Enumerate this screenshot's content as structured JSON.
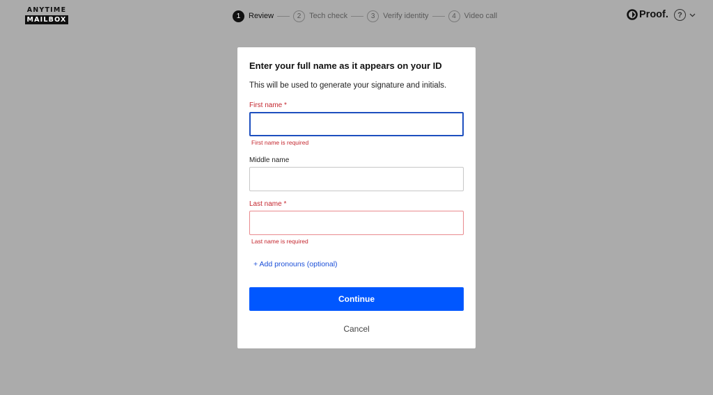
{
  "header": {
    "logo": {
      "line1": "ANYTIME",
      "line2": "MAILBOX"
    },
    "steps": [
      {
        "number": "1",
        "label": "Review",
        "active": true
      },
      {
        "number": "2",
        "label": "Tech check",
        "active": false
      },
      {
        "number": "3",
        "label": "Verify identity",
        "active": false
      },
      {
        "number": "4",
        "label": "Video call",
        "active": false
      }
    ],
    "brand": "Proof.",
    "help_glyph": "?"
  },
  "modal": {
    "title": "Enter your full name as it appears on your ID",
    "description": "This will be used to generate your signature and initials.",
    "first_name": {
      "label": "First name",
      "required_mark": "*",
      "value": "",
      "error": "First name is required"
    },
    "middle_name": {
      "label": "Middle name",
      "value": ""
    },
    "last_name": {
      "label": "Last name",
      "required_mark": "*",
      "value": "",
      "error": "Last name is required"
    },
    "add_pronouns": "+ Add pronouns (optional)",
    "continue": "Continue",
    "cancel": "Cancel"
  },
  "colors": {
    "backdrop": "#ababab",
    "primary": "#0057ff",
    "error": "#c4262e",
    "link": "#1a4ed8"
  }
}
